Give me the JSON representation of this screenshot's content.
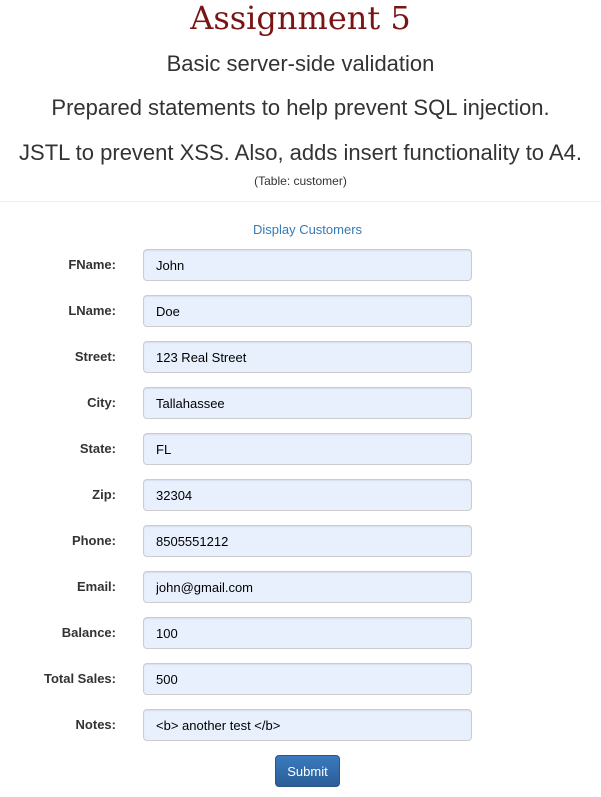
{
  "header": {
    "title": "Assignment 5",
    "subtitle1": "Basic server-side validation",
    "subtitle2": "Prepared statements to help prevent SQL injection.",
    "subtitle3": "JSTL to prevent XSS. Also, adds insert functionality to A4.",
    "table_note": "(Table: customer)"
  },
  "nav": {
    "display_link": "Display Customers"
  },
  "form": {
    "fields": [
      {
        "label": "FName:",
        "value": "John"
      },
      {
        "label": "LName:",
        "value": "Doe"
      },
      {
        "label": "Street:",
        "value": "123 Real Street"
      },
      {
        "label": "City:",
        "value": "Tallahassee"
      },
      {
        "label": "State:",
        "value": "FL"
      },
      {
        "label": "Zip:",
        "value": "32304"
      },
      {
        "label": "Phone:",
        "value": "8505551212"
      },
      {
        "label": "Email:",
        "value": "john@gmail.com"
      },
      {
        "label": "Balance:",
        "value": "100"
      },
      {
        "label": "Total Sales:",
        "value": "500"
      },
      {
        "label": "Notes:",
        "value": "<b> another test </b>"
      }
    ],
    "submit_label": "Submit"
  },
  "colors": {
    "title": "#7b1414",
    "link": "#337ab7",
    "input_bg": "#e8f0fe",
    "button": "#2f6aa8"
  }
}
